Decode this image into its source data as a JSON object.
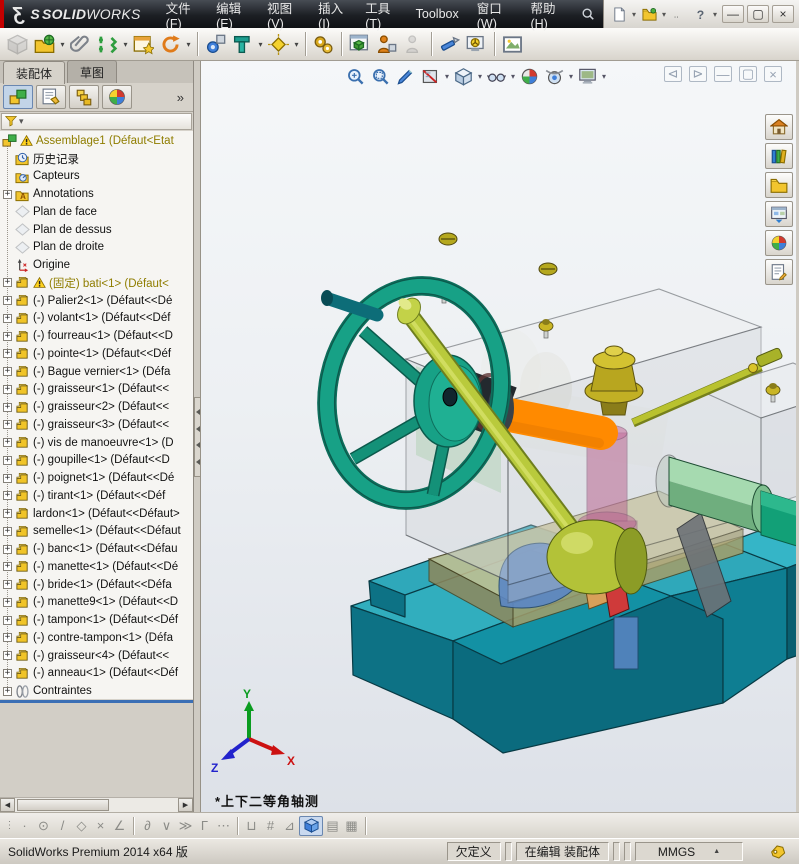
{
  "title_bar": {
    "logo_mark": "Ʒ",
    "logo_s": "S",
    "brand_bold": "SOLID",
    "brand_light": "WORKS",
    "menus": [
      "文件(F)",
      "编辑(E)",
      "视图(V)",
      "插入(I)",
      "工具(T)",
      "Toolbox",
      "窗口(W)",
      "帮助(H)"
    ],
    "quick_icons": [
      {
        "name": "new-document-button",
        "icon": "new-doc",
        "dropdown": true
      },
      {
        "name": "open-document-button",
        "icon": "open-folder",
        "dropdown": true
      },
      {
        "name": "options-button",
        "icon": "dots",
        "dropdown": false
      },
      {
        "name": "help-button",
        "icon": "help",
        "dropdown": true
      }
    ],
    "window_buttons": [
      {
        "name": "minimize-button",
        "glyph": "—"
      },
      {
        "name": "restore-button",
        "glyph": "▢"
      },
      {
        "name": "close-button",
        "glyph": "×"
      }
    ],
    "caret": "▾"
  },
  "main_toolbar": {
    "items": [
      {
        "name": "insert-component-button",
        "icon": "tb-cube-gray",
        "disabled": true
      },
      {
        "name": "open-from-web-button",
        "icon": "tb-folder-globe",
        "dropdown": true
      },
      {
        "name": "attachment-button",
        "icon": "tb-clip"
      },
      {
        "name": "mate-button",
        "icon": "tb-mate",
        "dropdown": true
      },
      {
        "name": "component-preview-button",
        "icon": "tb-winstar"
      },
      {
        "name": "rotate-component-button",
        "icon": "tb-loop",
        "dropdown": true
      },
      {
        "sep": true
      },
      {
        "name": "move-component-button",
        "icon": "tb-gearcube"
      },
      {
        "name": "show-hidden-components-button",
        "icon": "tb-tgreen",
        "dropdown": true
      },
      {
        "name": "smart-fasteners-button",
        "icon": "tb-diamond",
        "dropdown": true
      },
      {
        "sep": true
      },
      {
        "name": "motion-study-button",
        "icon": "tb-gears"
      },
      {
        "sep": true
      },
      {
        "name": "exploded-view-button",
        "icon": "tb-wincube"
      },
      {
        "name": "assembly-xpert-button",
        "icon": "tb-person-orange"
      },
      {
        "name": "component-pattern-button",
        "icon": "tb-person-gray",
        "disabled": true
      },
      {
        "sep": true
      },
      {
        "name": "measure-button",
        "icon": "tb-knife"
      },
      {
        "name": "interference-detection-button",
        "icon": "tb-monitor-warn"
      },
      {
        "sep": true
      },
      {
        "name": "image-capture-button",
        "icon": "tb-frame"
      }
    ]
  },
  "left_panel": {
    "doc_tabs": [
      {
        "label": "装配体",
        "active": true
      },
      {
        "label": "草图",
        "active": false
      }
    ],
    "manager_tabs": [
      {
        "name": "featuremanager-tree-tab",
        "icon": "mgr-assembly",
        "active": true
      },
      {
        "name": "propertymanager-tab",
        "icon": "mgr-props",
        "active": false
      },
      {
        "name": "configurationmanager-tab",
        "icon": "mgr-config",
        "active": false
      },
      {
        "name": "displaymanager-tab",
        "icon": "mgr-display",
        "active": false
      }
    ],
    "overflow_label": "»",
    "filter_caret": "▾",
    "tree": [
      {
        "icon": "assembly",
        "label": "Assemblage1  (Défaut<Etat",
        "root": true,
        "warn": true,
        "olive": true
      },
      {
        "icon": "history",
        "label": "历史记录"
      },
      {
        "icon": "sensors",
        "label": "Capteurs"
      },
      {
        "icon": "annotations",
        "label": "Annotations",
        "exp": true
      },
      {
        "icon": "plane",
        "label": "Plan de face"
      },
      {
        "icon": "plane",
        "label": "Plan de dessus"
      },
      {
        "icon": "plane",
        "label": "Plan de droite"
      },
      {
        "icon": "origin",
        "label": "Origine"
      },
      {
        "icon": "part",
        "label": "(固定) bati<1> (Défaut<",
        "exp": true,
        "warn": true,
        "olive": true
      },
      {
        "icon": "part",
        "label": "(-) Palier2<1> (Défaut<<Dé",
        "exp": true
      },
      {
        "icon": "part",
        "label": "(-) volant<1> (Défaut<<Déf",
        "exp": true
      },
      {
        "icon": "part",
        "label": "(-) fourreau<1> (Défaut<<D",
        "exp": true
      },
      {
        "icon": "part",
        "label": "(-) pointe<1> (Défaut<<Déf",
        "exp": true
      },
      {
        "icon": "part",
        "label": "(-) Bague vernier<1> (Défa",
        "exp": true
      },
      {
        "icon": "part",
        "label": "(-) graisseur<1> (Défaut<<",
        "exp": true
      },
      {
        "icon": "part",
        "label": "(-) graisseur<2> (Défaut<<",
        "exp": true
      },
      {
        "icon": "part",
        "label": "(-) graisseur<3> (Défaut<<",
        "exp": true
      },
      {
        "icon": "part",
        "label": "(-) vis de manoeuvre<1> (D",
        "exp": true
      },
      {
        "icon": "part",
        "label": "(-) goupille<1> (Défaut<<D",
        "exp": true
      },
      {
        "icon": "part",
        "label": "(-) poignet<1> (Défaut<<Dé",
        "exp": true
      },
      {
        "icon": "part",
        "label": "(-) tirant<1> (Défaut<<Déf",
        "exp": true
      },
      {
        "icon": "part",
        "label": "lardon<1> (Défaut<<Défaut>",
        "exp": true
      },
      {
        "icon": "part",
        "label": "semelle<1> (Défaut<<Défaut",
        "exp": true
      },
      {
        "icon": "part",
        "label": "(-) banc<1> (Défaut<<Défau",
        "exp": true
      },
      {
        "icon": "part",
        "label": "(-) manette<1> (Défaut<<Dé",
        "exp": true
      },
      {
        "icon": "part",
        "label": "(-) bride<1> (Défaut<<Défa",
        "exp": true
      },
      {
        "icon": "part",
        "label": "(-) manette9<1> (Défaut<<D",
        "exp": true
      },
      {
        "icon": "part",
        "label": "(-) tampon<1> (Défaut<<Déf",
        "exp": true
      },
      {
        "icon": "part",
        "label": "(-) contre-tampon<1> (Défa",
        "exp": true
      },
      {
        "icon": "part",
        "label": "(-) graisseur<4> (Défaut<<",
        "exp": true
      },
      {
        "icon": "part",
        "label": "(-) anneau<1> (Défaut<<Déf",
        "exp": true
      },
      {
        "icon": "mates",
        "label": "Contraintes",
        "exp": true
      }
    ]
  },
  "viewport": {
    "headsup": [
      {
        "name": "zoom-to-fit-button",
        "icon": "hu-zoomfit"
      },
      {
        "name": "zoom-to-area-button",
        "icon": "hu-zoomarea"
      },
      {
        "name": "previous-view-button",
        "icon": "hu-pen"
      },
      {
        "name": "section-view-button",
        "icon": "hu-section",
        "dropdown": true
      },
      {
        "name": "view-orientation-button",
        "icon": "hu-cube",
        "dropdown": true
      },
      {
        "name": "hide-show-items-button",
        "icon": "hu-glasses",
        "dropdown": true
      },
      {
        "name": "edit-appearance-button",
        "icon": "hu-ball"
      },
      {
        "name": "apply-scene-button",
        "icon": "hu-scene",
        "dropdown": true
      },
      {
        "name": "view-settings-button",
        "icon": "hu-monitor",
        "dropdown": true
      }
    ],
    "doc_window_buttons": [
      {
        "name": "pane-left-button",
        "glyph": "⊲"
      },
      {
        "name": "pane-right-button",
        "glyph": "⊳"
      },
      {
        "name": "doc-minimize-button",
        "glyph": "—"
      },
      {
        "name": "doc-restore-button",
        "glyph": "▢"
      },
      {
        "name": "doc-close-button",
        "glyph": "×"
      }
    ],
    "task_pane": [
      {
        "name": "task-pane-home-button",
        "icon": "tp-home"
      },
      {
        "name": "design-library-button",
        "icon": "tp-library"
      },
      {
        "name": "file-explorer-button",
        "icon": "tp-folder"
      },
      {
        "name": "view-palette-button",
        "icon": "tp-palette"
      },
      {
        "name": "appearances-scenes-button",
        "icon": "tp-ball"
      },
      {
        "name": "custom-properties-button",
        "icon": "tp-props"
      }
    ],
    "view_label": "*上下二等角轴测",
    "triad": {
      "x": "X",
      "y": "Y",
      "z": "Z"
    },
    "model": {
      "selection_color": "#ff8a00",
      "base_color": "#0b6b7e",
      "wheel_color": "#17a186",
      "lever_color": "#b9ca3c",
      "visible_parts": [
        "banc",
        "bati",
        "volant",
        "manette",
        "vis de manoeuvre",
        "fourreau",
        "pointe",
        "poignet",
        "tirant",
        "tampon",
        "semelle",
        "lardon",
        "graisseur"
      ]
    }
  },
  "snap_toolbar": {
    "items": [
      {
        "name": "snapbar-drag-handle",
        "glyph": "⋮",
        "small": true
      },
      {
        "name": "point-snap-button",
        "glyph": "·"
      },
      {
        "name": "center-snap-button",
        "glyph": "⊙"
      },
      {
        "name": "line-snap-button",
        "glyph": "/"
      },
      {
        "name": "polygon-snap-button",
        "glyph": "◇"
      },
      {
        "name": "intersection-snap-button",
        "glyph": "×"
      },
      {
        "name": "angle-snap-button",
        "glyph": "∠"
      },
      {
        "sep": true
      },
      {
        "name": "tangent-snap-button",
        "glyph": "∂"
      },
      {
        "name": "nearest-snap-button",
        "glyph": "∨"
      },
      {
        "name": "parallel-snap-button",
        "glyph": "≫"
      },
      {
        "name": "perpendicular-snap-button",
        "glyph": "Γ"
      },
      {
        "name": "spline-snap-button",
        "glyph": "⋯"
      },
      {
        "sep": true
      },
      {
        "name": "dimension-snap-button",
        "glyph": "⊔"
      },
      {
        "name": "grid-snap-button",
        "glyph": "#"
      },
      {
        "name": "angle-grid-snap-button",
        "glyph": "⊿"
      },
      {
        "name": "view-cube-button",
        "icon": "cube3d",
        "active": true
      },
      {
        "name": "split-horizontal-button",
        "glyph": "▤"
      },
      {
        "name": "split-grid-button",
        "glyph": "▦"
      },
      {
        "sep": true
      }
    ]
  },
  "status_bar": {
    "product": "SolidWorks Premium 2014 x64 版",
    "state": "欠定义",
    "editing": "在编辑 装配体",
    "units": "MMGS",
    "units_caret": "▲"
  }
}
